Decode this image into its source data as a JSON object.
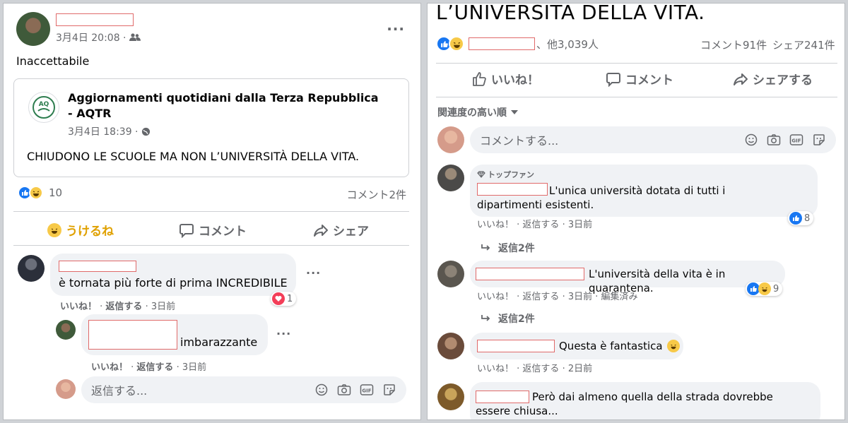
{
  "left": {
    "post": {
      "timestamp": "3月4日 20:08 ·",
      "text": "Inaccettabile"
    },
    "shared": {
      "page_name": "Aggiornamenti quotidiani dalla Terza Repubblica - AQTR",
      "timestamp": "3月4日 18:39 ·",
      "text": "CHIUDONO LE SCUOLE MA NON L’UNIVERSITÀ DELLA VITA."
    },
    "reactions": {
      "count": "10",
      "comments": "コメント2件"
    },
    "buttons": {
      "react": "うけるね",
      "comment": "コメント",
      "share": "シェア"
    },
    "comments": [
      {
        "text": "è tornata più forte di prima INCREDIBILE",
        "like": "いいね！",
        "reply": "返信する",
        "time": "3日前",
        "reaction_count": "1"
      },
      {
        "text": "imbarazzante",
        "like": "いいね！",
        "reply": "返信する",
        "time": "3日前"
      }
    ],
    "reply_input": {
      "placeholder": "返信する..."
    }
  },
  "right": {
    "title": "L’UNIVERSITÀ DELLA VITA.",
    "reaction_summary": "、他3,039人",
    "comment_count": "コメント91件",
    "share_count": "シェア241件",
    "buttons": {
      "like": "いいね！",
      "comment": "コメント",
      "share": "シェアする"
    },
    "sort_label": "関連度の高い順",
    "comment_input": {
      "placeholder": "コメントする..."
    },
    "comments": [
      {
        "badge": "トップファン",
        "text": "L'unica università dotata di tutti i dipartimenti esistenti.",
        "like": "いいね！",
        "reply": "返信する",
        "time": "3日前",
        "reaction_count": "8",
        "replies": "返信2件"
      },
      {
        "text": "L'università della vita è in quarantena.",
        "like": "いいね！",
        "reply": "返信する",
        "time": "3日前",
        "edited": "編集済み",
        "reaction_count": "9",
        "replies": "返信2件"
      },
      {
        "text": "Questa è fantastica",
        "like": "いいね！",
        "reply": "返信する",
        "time": "2日前"
      },
      {
        "text": "Però dai almeno quella della strada dovrebbe essere chiusa..."
      }
    ]
  },
  "colors": {
    "accent": "#1877f2",
    "haha": "#f7b928",
    "bubble": "#f0f2f5"
  },
  "icons": [
    "friends-icon",
    "globe-icon",
    "like-icon",
    "haha-icon",
    "love-icon",
    "comment-icon",
    "share-icon",
    "emoji-icon",
    "camera-icon",
    "gif-icon",
    "sticker-icon",
    "reply-arrow-icon",
    "top-fan-icon",
    "dropdown-icon",
    "more-icon"
  ]
}
